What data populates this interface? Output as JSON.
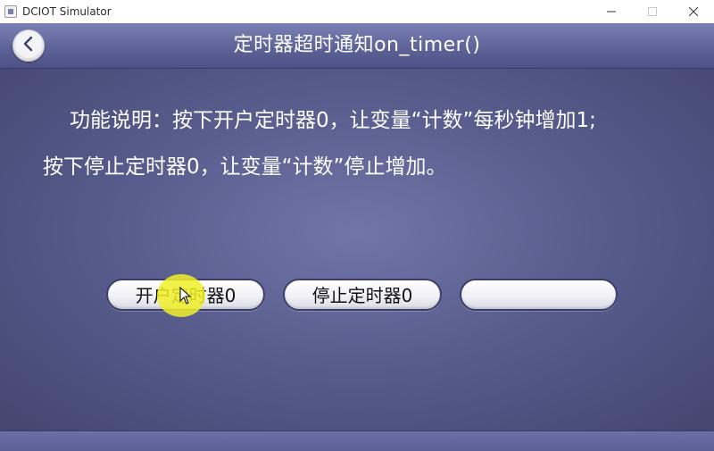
{
  "window": {
    "title": "DCIOT Simulator",
    "minimize_icon": "minimize-icon",
    "maximize_icon": "maximize-icon",
    "close_icon": "close-icon"
  },
  "header": {
    "back_icon": "chevron-left-icon",
    "title": "定时器超时通知on_timer()",
    "accent_color": "#5e6398"
  },
  "description": {
    "line1": "功能说明：按下开户定时器0，让变量“计数”每秒钟增加1;",
    "line2": "按下停止定时器0，让变量“计数”停止增加。"
  },
  "buttons": {
    "start_timer": "开户定时器0",
    "stop_timer": "停止定时器0",
    "third": ""
  }
}
